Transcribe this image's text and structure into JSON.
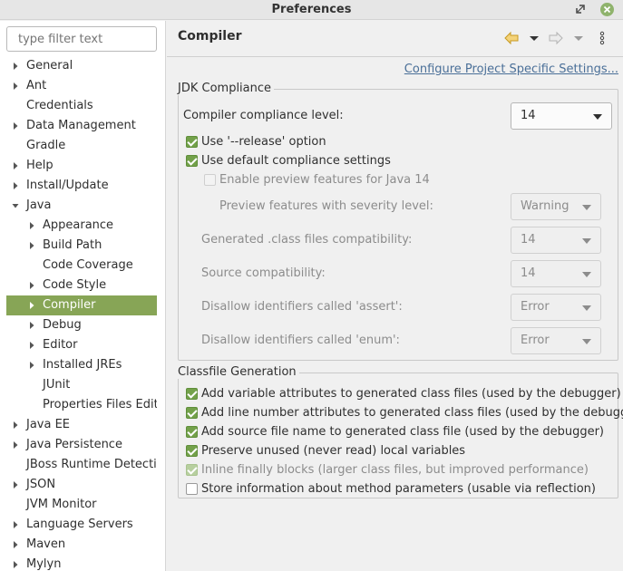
{
  "window": {
    "title": "Preferences"
  },
  "sidebar": {
    "filter_placeholder": "type filter text",
    "items": [
      {
        "label": "General",
        "level": 0,
        "expander": "collapsed"
      },
      {
        "label": "Ant",
        "level": 0,
        "expander": "collapsed"
      },
      {
        "label": "Credentials",
        "level": 0,
        "expander": "none"
      },
      {
        "label": "Data Management",
        "level": 0,
        "expander": "collapsed"
      },
      {
        "label": "Gradle",
        "level": 0,
        "expander": "none"
      },
      {
        "label": "Help",
        "level": 0,
        "expander": "collapsed"
      },
      {
        "label": "Install/Update",
        "level": 0,
        "expander": "collapsed"
      },
      {
        "label": "Java",
        "level": 0,
        "expander": "expanded"
      },
      {
        "label": "Appearance",
        "level": 1,
        "expander": "collapsed"
      },
      {
        "label": "Build Path",
        "level": 1,
        "expander": "collapsed"
      },
      {
        "label": "Code Coverage",
        "level": 1,
        "expander": "none"
      },
      {
        "label": "Code Style",
        "level": 1,
        "expander": "collapsed"
      },
      {
        "label": "Compiler",
        "level": 1,
        "expander": "collapsed",
        "selected": true
      },
      {
        "label": "Debug",
        "level": 1,
        "expander": "collapsed"
      },
      {
        "label": "Editor",
        "level": 1,
        "expander": "collapsed"
      },
      {
        "label": "Installed JREs",
        "level": 1,
        "expander": "collapsed"
      },
      {
        "label": "JUnit",
        "level": 1,
        "expander": "none"
      },
      {
        "label": "Properties Files Edito",
        "level": 1,
        "expander": "none"
      },
      {
        "label": "Java EE",
        "level": 0,
        "expander": "collapsed"
      },
      {
        "label": "Java Persistence",
        "level": 0,
        "expander": "collapsed"
      },
      {
        "label": "JBoss Runtime Detectio",
        "level": 0,
        "expander": "none"
      },
      {
        "label": "JSON",
        "level": 0,
        "expander": "collapsed"
      },
      {
        "label": "JVM Monitor",
        "level": 0,
        "expander": "none"
      },
      {
        "label": "Language Servers",
        "level": 0,
        "expander": "collapsed"
      },
      {
        "label": "Maven",
        "level": 0,
        "expander": "collapsed"
      },
      {
        "label": "Mylyn",
        "level": 0,
        "expander": "collapsed"
      }
    ]
  },
  "page": {
    "title": "Compiler",
    "toolbar_icons": [
      "back-arrow-icon",
      "back-menu-icon",
      "forward-arrow-icon",
      "forward-menu-icon",
      "view-menu-icon"
    ],
    "configure_link": "Configure Project Specific Settings..."
  },
  "jdk": {
    "group_title": "JDK Compliance",
    "compliance_label": "Compiler compliance level:",
    "compliance_value": "14",
    "release_label": "Use '--release' option",
    "release_checked": true,
    "default_label": "Use default compliance settings",
    "default_checked": true,
    "preview_label": "Enable preview features for Java 14",
    "preview_checked": false,
    "severity_label": "Preview features with severity level:",
    "severity_value": "Warning",
    "generated_label": "Generated .class files compatibility:",
    "generated_value": "14",
    "source_label": "Source compatibility:",
    "source_value": "14",
    "assert_label": "Disallow identifiers called 'assert':",
    "assert_value": "Error",
    "enum_label": "Disallow identifiers called 'enum':",
    "enum_value": "Error"
  },
  "classfile": {
    "group_title": "Classfile Generation",
    "options": [
      {
        "label": "Add variable attributes to generated class files (used by the debugger)",
        "checked": true,
        "enabled": true
      },
      {
        "label": "Add line number attributes to generated class files (used by the debugger)",
        "checked": true,
        "enabled": true
      },
      {
        "label": "Add source file name to generated class file (used by the debugger)",
        "checked": true,
        "enabled": true
      },
      {
        "label": "Preserve unused (never read) local variables",
        "checked": true,
        "enabled": true
      },
      {
        "label": "Inline finally blocks (larger class files, but improved performance)",
        "checked": true,
        "enabled": false
      },
      {
        "label": "Store information about method parameters (usable via reflection)",
        "checked": false,
        "enabled": true
      }
    ]
  },
  "colors": {
    "selection": "#87a556",
    "checkbox_accent": "#73a14a",
    "link": "#4a6f98",
    "toolbar_arrow": "#e0b73a"
  }
}
